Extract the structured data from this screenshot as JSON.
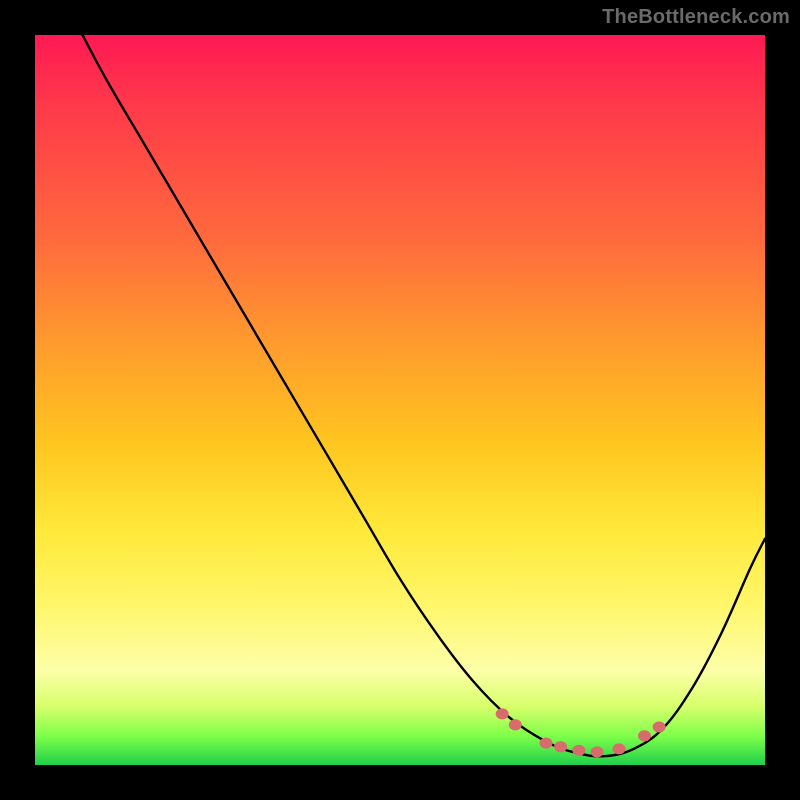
{
  "watermark": "TheBottleneck.com",
  "colors": {
    "background": "#000000",
    "watermark_text": "#6a6a6a",
    "curve_stroke": "#000000",
    "marker_fill": "#d86b6b",
    "gradient_stops": [
      {
        "pos": 0.0,
        "hex": "#ff1a53"
      },
      {
        "pos": 0.1,
        "hex": "#ff3a4a"
      },
      {
        "pos": 0.28,
        "hex": "#ff6a3d"
      },
      {
        "pos": 0.42,
        "hex": "#ff9a2e"
      },
      {
        "pos": 0.56,
        "hex": "#ffc61f"
      },
      {
        "pos": 0.68,
        "hex": "#ffe93a"
      },
      {
        "pos": 0.78,
        "hex": "#fff66a"
      },
      {
        "pos": 0.87,
        "hex": "#fdffa8"
      },
      {
        "pos": 0.92,
        "hex": "#d7ff6a"
      },
      {
        "pos": 0.96,
        "hex": "#7fff4a"
      },
      {
        "pos": 1.0,
        "hex": "#1fd04a"
      }
    ]
  },
  "chart_data": {
    "type": "line",
    "title": "",
    "xlabel": "",
    "ylabel": "",
    "x_range_normalized": [
      0,
      1
    ],
    "y_range_normalized": [
      0,
      1
    ],
    "series": [
      {
        "name": "bottleneck-curve",
        "note": "V-shaped curve; minimum near x≈0.78. Values are normalized fractions of plot width/height (y=0 top, y=1 bottom).",
        "points": [
          {
            "x": 0.065,
            "y": 0.0
          },
          {
            "x": 0.1,
            "y": 0.065
          },
          {
            "x": 0.15,
            "y": 0.15
          },
          {
            "x": 0.2,
            "y": 0.235
          },
          {
            "x": 0.25,
            "y": 0.32
          },
          {
            "x": 0.3,
            "y": 0.405
          },
          {
            "x": 0.35,
            "y": 0.49
          },
          {
            "x": 0.4,
            "y": 0.575
          },
          {
            "x": 0.45,
            "y": 0.66
          },
          {
            "x": 0.5,
            "y": 0.745
          },
          {
            "x": 0.55,
            "y": 0.82
          },
          {
            "x": 0.6,
            "y": 0.885
          },
          {
            "x": 0.65,
            "y": 0.935
          },
          {
            "x": 0.7,
            "y": 0.968
          },
          {
            "x": 0.74,
            "y": 0.983
          },
          {
            "x": 0.78,
            "y": 0.988
          },
          {
            "x": 0.82,
            "y": 0.978
          },
          {
            "x": 0.86,
            "y": 0.95
          },
          {
            "x": 0.9,
            "y": 0.895
          },
          {
            "x": 0.94,
            "y": 0.82
          },
          {
            "x": 0.98,
            "y": 0.73
          },
          {
            "x": 1.0,
            "y": 0.69
          }
        ]
      }
    ],
    "markers": {
      "name": "sweet-spot-dots",
      "style": "filled-circle",
      "radius_px_approx": 6,
      "points": [
        {
          "x": 0.64,
          "y": 0.93
        },
        {
          "x": 0.658,
          "y": 0.945
        },
        {
          "x": 0.7,
          "y": 0.97
        },
        {
          "x": 0.72,
          "y": 0.975
        },
        {
          "x": 0.745,
          "y": 0.98
        },
        {
          "x": 0.77,
          "y": 0.982
        },
        {
          "x": 0.8,
          "y": 0.978
        },
        {
          "x": 0.835,
          "y": 0.96
        },
        {
          "x": 0.855,
          "y": 0.948
        }
      ]
    }
  }
}
